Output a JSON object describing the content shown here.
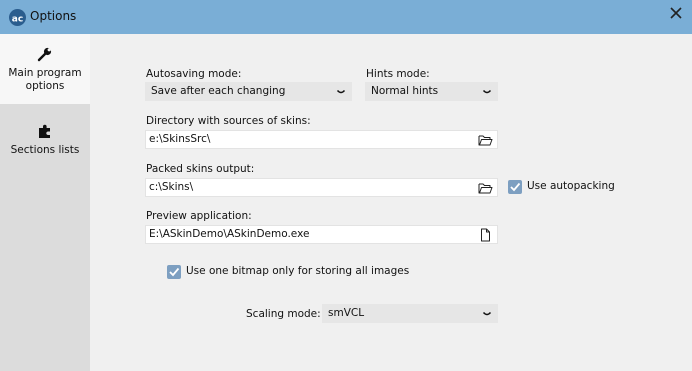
{
  "window": {
    "title": "Options",
    "close_icon": "close-icon",
    "app_icon": "alphacontrols-logo-icon"
  },
  "sidebar": {
    "items": [
      {
        "label_line1": "Main program",
        "label_line2": "options",
        "icon": "wrench-icon",
        "active": true
      },
      {
        "label": "Sections lists",
        "icon": "puzzle-icon",
        "active": false
      }
    ]
  },
  "form": {
    "autosaving": {
      "label": "Autosaving mode:",
      "value": "Save after each changing"
    },
    "hints": {
      "label": "Hints mode:",
      "value": "Normal hints"
    },
    "skins_dir": {
      "label": "Directory with sources of skins:",
      "value": "e:\\SkinsSrc\\"
    },
    "packed_output": {
      "label": "Packed skins output:",
      "value": "c:\\Skins\\"
    },
    "use_autopacking": {
      "label": "Use autopacking",
      "checked": true
    },
    "preview_app": {
      "label": "Preview application:",
      "value": "E:\\ASkinDemo\\ASkinDemo.exe"
    },
    "one_bitmap": {
      "label": "Use one bitmap only for storing all images",
      "checked": true
    },
    "scaling": {
      "label": "Scaling mode:",
      "value": "smVCL"
    }
  },
  "colors": {
    "titlebar": "#7aaed6",
    "checkbox": "#7d9fc1",
    "sidebar": "#dcdcdc",
    "content": "#f0f0f0"
  }
}
